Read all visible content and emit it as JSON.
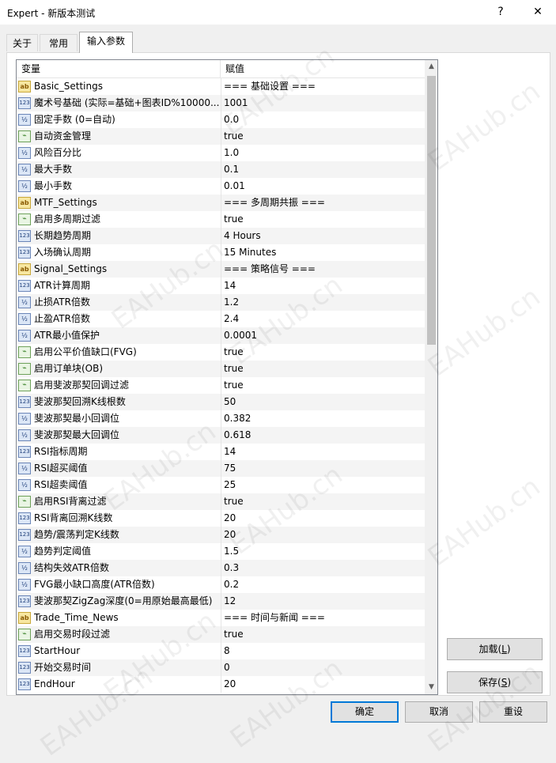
{
  "window": {
    "title": "Expert - 新版本测试",
    "help_label": "?",
    "close_label": "✕"
  },
  "tabs": [
    {
      "label": "关于"
    },
    {
      "label": "常用"
    },
    {
      "label": "输入参数"
    }
  ],
  "table": {
    "headers": {
      "variable": "变量",
      "value": "赋值"
    },
    "rows": [
      {
        "type": "str",
        "icon": "string-type-icon",
        "name": "Basic_Settings",
        "value": "=== 基础设置 ==="
      },
      {
        "type": "int",
        "icon": "integer-type-icon",
        "name": "魔术号基础 (实际=基础+图表ID%10000...",
        "value": "1001"
      },
      {
        "type": "dbl",
        "icon": "double-type-icon",
        "name": "固定手数 (0=自动)",
        "value": "0.0"
      },
      {
        "type": "bool",
        "icon": "bool-type-icon",
        "name": "自动资金管理",
        "value": "true"
      },
      {
        "type": "dbl",
        "icon": "double-type-icon",
        "name": "风险百分比",
        "value": "1.0"
      },
      {
        "type": "dbl",
        "icon": "double-type-icon",
        "name": "最大手数",
        "value": "0.1"
      },
      {
        "type": "dbl",
        "icon": "double-type-icon",
        "name": "最小手数",
        "value": "0.01"
      },
      {
        "type": "str",
        "icon": "string-type-icon",
        "name": "MTF_Settings",
        "value": "=== 多周期共振 ==="
      },
      {
        "type": "bool",
        "icon": "bool-type-icon",
        "name": "启用多周期过滤",
        "value": "true"
      },
      {
        "type": "int",
        "icon": "integer-type-icon",
        "name": "长期趋势周期",
        "value": "4 Hours"
      },
      {
        "type": "int",
        "icon": "integer-type-icon",
        "name": "入场确认周期",
        "value": "15 Minutes"
      },
      {
        "type": "str",
        "icon": "string-type-icon",
        "name": "Signal_Settings",
        "value": "=== 策略信号 ==="
      },
      {
        "type": "int",
        "icon": "integer-type-icon",
        "name": "ATR计算周期",
        "value": "14"
      },
      {
        "type": "dbl",
        "icon": "double-type-icon",
        "name": "止损ATR倍数",
        "value": "1.2"
      },
      {
        "type": "dbl",
        "icon": "double-type-icon",
        "name": "止盈ATR倍数",
        "value": "2.4"
      },
      {
        "type": "dbl",
        "icon": "double-type-icon",
        "name": "ATR最小值保护",
        "value": "0.0001"
      },
      {
        "type": "bool",
        "icon": "bool-type-icon",
        "name": "启用公平价值缺口(FVG)",
        "value": "true"
      },
      {
        "type": "bool",
        "icon": "bool-type-icon",
        "name": "启用订单块(OB)",
        "value": "true"
      },
      {
        "type": "bool",
        "icon": "bool-type-icon",
        "name": "启用斐波那契回调过滤",
        "value": "true"
      },
      {
        "type": "int",
        "icon": "integer-type-icon",
        "name": "斐波那契回溯K线根数",
        "value": "50"
      },
      {
        "type": "dbl",
        "icon": "double-type-icon",
        "name": "斐波那契最小回调位",
        "value": "0.382"
      },
      {
        "type": "dbl",
        "icon": "double-type-icon",
        "name": "斐波那契最大回调位",
        "value": "0.618"
      },
      {
        "type": "int",
        "icon": "integer-type-icon",
        "name": "RSI指标周期",
        "value": "14"
      },
      {
        "type": "dbl",
        "icon": "double-type-icon",
        "name": "RSI超买阈值",
        "value": "75"
      },
      {
        "type": "dbl",
        "icon": "double-type-icon",
        "name": "RSI超卖阈值",
        "value": "25"
      },
      {
        "type": "bool",
        "icon": "bool-type-icon",
        "name": "启用RSI背离过滤",
        "value": "true"
      },
      {
        "type": "int",
        "icon": "integer-type-icon",
        "name": "RSI背离回溯K线数",
        "value": "20"
      },
      {
        "type": "int",
        "icon": "integer-type-icon",
        "name": "趋势/震荡判定K线数",
        "value": "20"
      },
      {
        "type": "dbl",
        "icon": "double-type-icon",
        "name": "趋势判定阈值",
        "value": "1.5"
      },
      {
        "type": "dbl",
        "icon": "double-type-icon",
        "name": "结构失效ATR倍数",
        "value": "0.3"
      },
      {
        "type": "dbl",
        "icon": "double-type-icon",
        "name": "FVG最小缺口高度(ATR倍数)",
        "value": "0.2"
      },
      {
        "type": "int",
        "icon": "integer-type-icon",
        "name": "斐波那契ZigZag深度(0=用原始最高最低)",
        "value": "12"
      },
      {
        "type": "str",
        "icon": "string-type-icon",
        "name": "Trade_Time_News",
        "value": "=== 时间与新闻 ==="
      },
      {
        "type": "bool",
        "icon": "bool-type-icon",
        "name": "启用交易时段过滤",
        "value": "true"
      },
      {
        "type": "int",
        "icon": "integer-type-icon",
        "name": "StartHour",
        "value": "8"
      },
      {
        "type": "int",
        "icon": "integer-type-icon",
        "name": "开始交易时间",
        "value": "0"
      },
      {
        "type": "int",
        "icon": "integer-type-icon",
        "name": "EndHour",
        "value": "20"
      }
    ]
  },
  "icon_glyphs": {
    "str": "ab",
    "int": "123",
    "dbl": "½",
    "bool": "⌁"
  },
  "buttons": {
    "load": {
      "label": "加载",
      "key": "L"
    },
    "save": {
      "label": "保存",
      "key": "S"
    },
    "ok": "确定",
    "cancel": "取消",
    "reset": "重设"
  },
  "watermark": "EAHub.cn"
}
